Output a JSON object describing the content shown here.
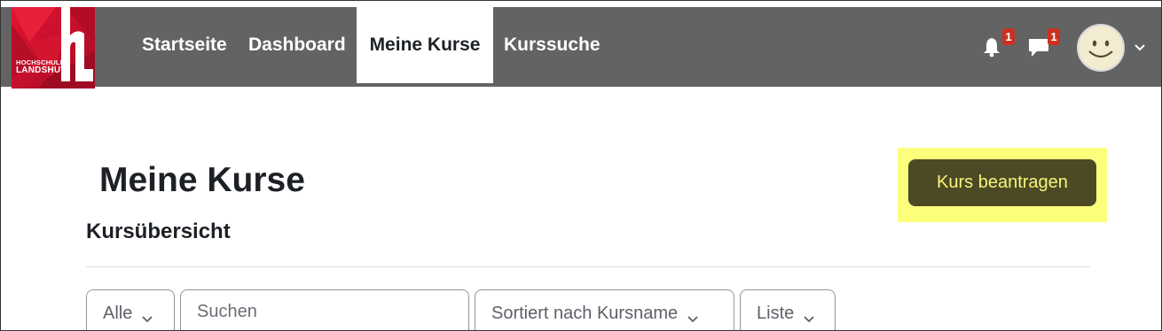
{
  "logo": {
    "line1": "HOCHSCHULE",
    "line2": "LANDSHUT"
  },
  "nav": {
    "items": [
      {
        "label": "Startseite"
      },
      {
        "label": "Dashboard"
      },
      {
        "label": "Meine Kurse",
        "active": true
      },
      {
        "label": "Kurssuche"
      }
    ],
    "notifications": {
      "icon": "bell-icon",
      "count": "1"
    },
    "messages": {
      "icon": "chat-icon",
      "count": "1"
    },
    "user_menu": {
      "icon": "avatar-smiley",
      "chevron": "chevron-down-icon"
    }
  },
  "main": {
    "page_title": "Meine Kurse",
    "request_button": "Kurs beantragen",
    "section_title": "Kursübersicht",
    "filters": {
      "grouping": {
        "selected": "Alle"
      },
      "search": {
        "placeholder": "Suchen"
      },
      "sort": {
        "selected": "Sortiert nach Kursname"
      },
      "view": {
        "selected": "Liste"
      }
    }
  },
  "colors": {
    "navbar_bg": "#636363",
    "brand_red": "#c8102e",
    "badge_red": "#ca3120",
    "button_bg": "#4c4a25",
    "button_text": "#f7f57a",
    "highlight": "#fbff7b"
  }
}
